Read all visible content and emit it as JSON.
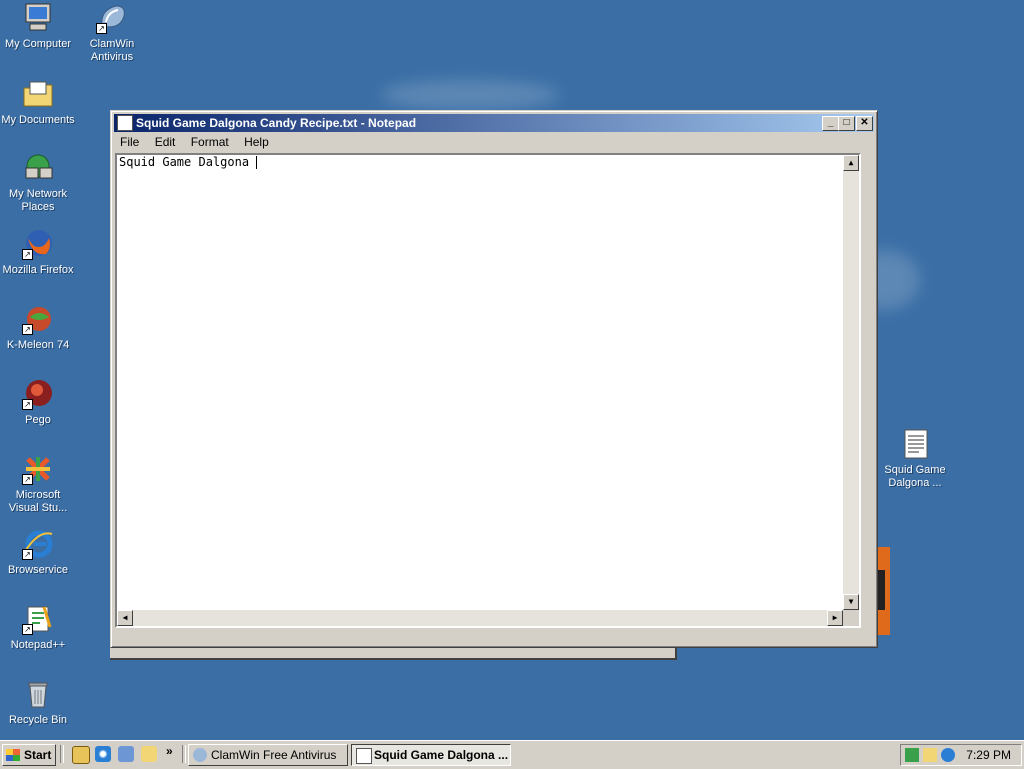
{
  "desktop": {
    "icons_left": [
      {
        "label": "My Computer",
        "icon": "computer-icon"
      },
      {
        "label": "My Documents",
        "icon": "folder-icon"
      },
      {
        "label": "My Network Places",
        "icon": "network-icon"
      },
      {
        "label": "Mozilla Firefox",
        "icon": "firefox-icon"
      },
      {
        "label": "K-Meleon 74",
        "icon": "kmeleon-icon"
      },
      {
        "label": "Pego",
        "icon": "pego-icon"
      },
      {
        "label": "Microsoft Visual Stu...",
        "icon": "visual-studio-icon"
      },
      {
        "label": "Browservice",
        "icon": "ie-icon"
      },
      {
        "label": "Notepad++",
        "icon": "notepadpp-icon"
      },
      {
        "label": "Recycle Bin",
        "icon": "recycle-bin-icon"
      }
    ],
    "clamwin": {
      "label": "ClamWin Antivirus",
      "icon": "clamwin-icon"
    },
    "file": {
      "label": "Squid Game Dalgona ...",
      "icon": "text-file-icon"
    }
  },
  "notepad": {
    "title": "Squid Game Dalgona Candy Recipe.txt - Notepad",
    "menu": [
      "File",
      "Edit",
      "Format",
      "Help"
    ],
    "content": "Squid Game Dalgona ",
    "buttons": {
      "minimize": "_",
      "maximize": "□",
      "close": "✕"
    }
  },
  "taskbar": {
    "start_label": "Start",
    "tasks": [
      {
        "label": "ClamWin Free Antivirus",
        "active": false
      },
      {
        "label": "Squid Game Dalgona ...",
        "active": true
      }
    ],
    "quicklaunch_more": "»",
    "clock": "7:29 PM"
  }
}
